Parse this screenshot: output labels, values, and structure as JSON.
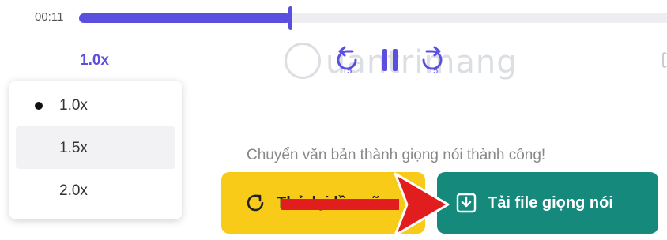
{
  "player": {
    "elapsed": "00:11",
    "progress_fraction": 0.36,
    "speed_current": "1.0x"
  },
  "speed_menu": {
    "options": [
      {
        "label": "1.0x",
        "selected": true
      },
      {
        "label": "1.5x",
        "selected": false
      },
      {
        "label": "2.0x",
        "selected": false
      }
    ]
  },
  "status": {
    "message": "Chuyển văn bản thành giọng nói thành công!"
  },
  "buttons": {
    "retry_label": "Thử lại lần nữa",
    "download_label": "Tải file giọng nói"
  },
  "watermark": {
    "text": "uantrimang"
  },
  "colors": {
    "accent": "#5b4fe0",
    "retry_bg": "#f8cb18",
    "download_bg": "#158a7c",
    "annotation_arrow": "#e11d1d"
  },
  "icons": {
    "rewind": "rewind-15-icon",
    "pause": "pause-icon",
    "forward": "forward-15-icon",
    "retry": "refresh-icon",
    "download": "download-icon"
  },
  "controls": {
    "skip_seconds": "15"
  }
}
